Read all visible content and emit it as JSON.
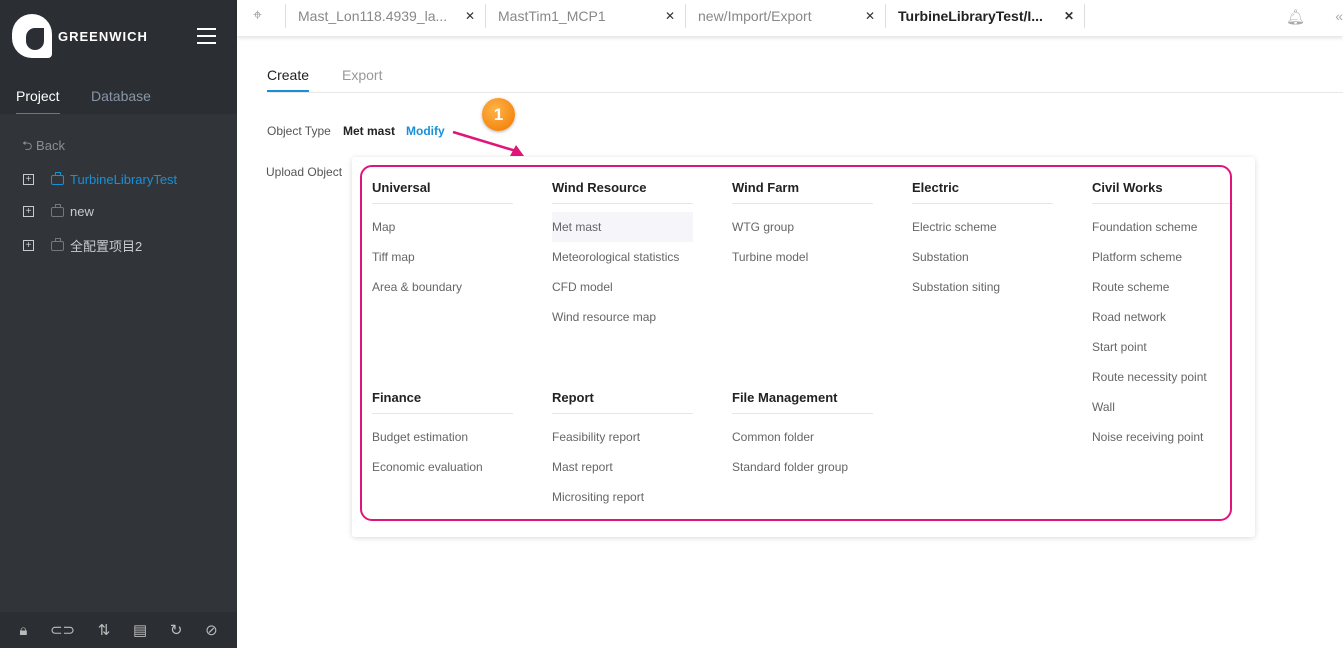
{
  "brand": {
    "name": "GREENWICH"
  },
  "sidebar": {
    "tabs": [
      "Project",
      "Database"
    ],
    "back": "Back",
    "tree": [
      "TurbineLibraryTest",
      "new",
      "全配置项目2"
    ],
    "footer_icons": [
      "lock-icon",
      "link-icon",
      "sort-icon",
      "document-icon",
      "refresh-icon",
      "hide-icon"
    ]
  },
  "tabs": [
    {
      "label": "Mast_Lon118.4939_la..."
    },
    {
      "label": "MastTim1_MCP1"
    },
    {
      "label": "new/Import/Export"
    },
    {
      "label": "TurbineLibraryTest/I..."
    }
  ],
  "content": {
    "tabs": [
      "Create",
      "Export"
    ],
    "object_type_label": "Object Type",
    "object_type_value": "Met mast",
    "modify": "Modify",
    "upload_label": "Upload Object"
  },
  "menu": {
    "groups": [
      {
        "title": "Universal",
        "items": [
          "Map",
          "Tiff map",
          "Area & boundary"
        ]
      },
      {
        "title": "Wind Resource",
        "items": [
          "Met mast",
          "Meteorological statistics",
          "CFD model",
          "Wind resource map"
        ]
      },
      {
        "title": "Wind Farm",
        "items": [
          "WTG group",
          "Turbine model"
        ]
      },
      {
        "title": "Electric",
        "items": [
          "Electric scheme",
          "Substation",
          "Substation siting"
        ]
      },
      {
        "title": "Civil Works",
        "items": [
          "Foundation scheme",
          "Platform scheme",
          "Route scheme",
          "Road network",
          "Start point",
          "Route necessity point",
          "Wall",
          "Noise receiving point"
        ]
      },
      {
        "title": "Finance",
        "items": [
          "Budget estimation",
          "Economic evaluation"
        ]
      },
      {
        "title": "Report",
        "items": [
          "Feasibility report",
          "Mast report",
          "Micrositing report"
        ]
      },
      {
        "title": "File Management",
        "items": [
          "Common folder",
          "Standard folder group"
        ]
      }
    ],
    "selected": "Met mast"
  },
  "annotation": {
    "badge": "1",
    "color": "#e0157a"
  },
  "colors": {
    "accent": "#1890d8",
    "sidebar": "#2b2f33"
  }
}
